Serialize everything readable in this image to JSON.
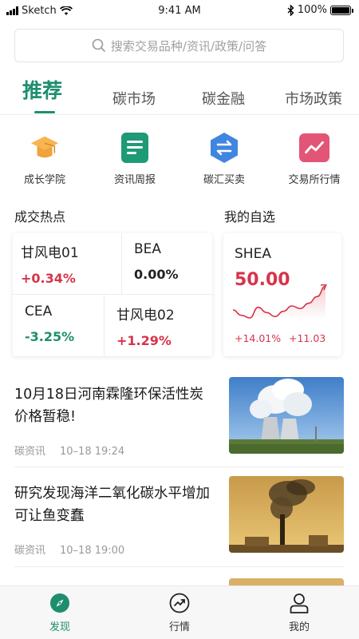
{
  "status_bar": {
    "carrier": "Sketch",
    "time": "9:41 AM",
    "battery": "100%"
  },
  "search": {
    "placeholder": "搜索交易品种/资讯/政策/问答"
  },
  "tabs": [
    {
      "label": "推荐",
      "active": true
    },
    {
      "label": "碳市场"
    },
    {
      "label": "碳金融"
    },
    {
      "label": "市场政策"
    }
  ],
  "quick_entries": [
    {
      "label": "成长学院",
      "icon": "graduation-cap-icon",
      "color": "#f0a23c"
    },
    {
      "label": "资讯周报",
      "icon": "document-icon",
      "color": "#1e9a76"
    },
    {
      "label": "碳汇买卖",
      "icon": "exchange-icon",
      "color": "#3f86e0"
    },
    {
      "label": "交易所行情",
      "icon": "trend-chart-icon",
      "color": "#e25576"
    }
  ],
  "sections": {
    "hot": "成交热点",
    "favorites": "我的自选"
  },
  "hot_items": [
    {
      "name": "甘风电01",
      "change": "+0.34%",
      "direction": "up"
    },
    {
      "name": "BEA",
      "change": "0.00%",
      "direction": "flat"
    },
    {
      "name": "CEA",
      "change": "-3.25%",
      "direction": "down"
    },
    {
      "name": "甘风电02",
      "change": "+1.29%",
      "direction": "up"
    }
  ],
  "favorite": {
    "name": "SHEA",
    "price": "50.00",
    "change_pct": "+14.01%",
    "change_abs": "+11.03",
    "sparkline": [
      42,
      38,
      36,
      44,
      40,
      37,
      41,
      45,
      43,
      47,
      52,
      60
    ]
  },
  "news": [
    {
      "title": "10月18日河南霖隆环保活性炭价格暂稳!",
      "source": "碳资讯",
      "time": "10–18 19:24",
      "image": "power-plant-cooling-towers"
    },
    {
      "title": "研究发现海洋二氧化碳水平增加可让鱼变蠢",
      "source": "碳资讯",
      "time": "10–18 19:00",
      "image": "smokestack-pollution"
    }
  ],
  "bottom_nav": [
    {
      "label": "发现",
      "icon": "compass-icon",
      "active": true
    },
    {
      "label": "行情",
      "icon": "trend-circle-icon"
    },
    {
      "label": "我的",
      "icon": "user-icon"
    }
  ],
  "colors": {
    "accent": "#1e8e6e",
    "up": "#d6344a",
    "down": "#1e8e6e"
  }
}
